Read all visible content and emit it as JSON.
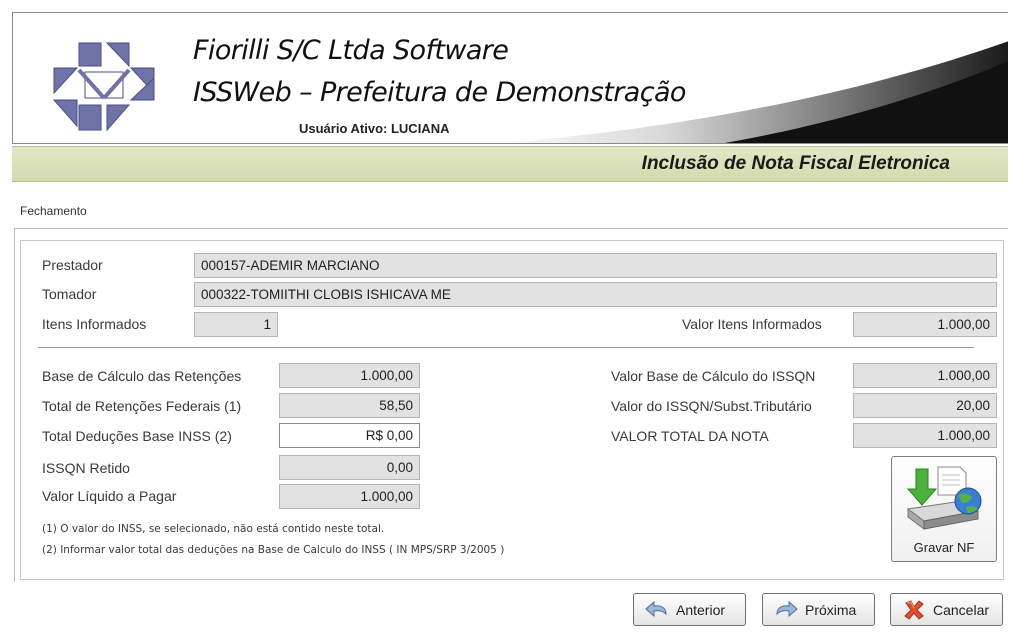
{
  "header": {
    "company": "Fiorilli S/C Ltda Software",
    "system": "ISSWeb – Prefeitura de Demonstração",
    "user_active": "Usuário Ativo: LUCIANA"
  },
  "page_title": "Inclusão de Nota Fiscal Eletronica",
  "tab": "Fechamento",
  "form": {
    "prestador_label": "Prestador",
    "prestador_value": "000157-ADEMIR MARCIANO",
    "tomador_label": "Tomador",
    "tomador_value": "000322-TOMIITHI CLOBIS ISHICAVA ME",
    "itens_label": "Itens Informados",
    "itens_value": "1",
    "valor_itens_label": "Valor Itens Informados",
    "valor_itens_value": "1.000,00",
    "base_retencoes_label": "Base de Cálculo das Retenções",
    "base_retencoes_value": "1.000,00",
    "total_retencoes_label": "Total de Retenções Federais (1)",
    "total_retencoes_value": "58,50",
    "total_deducoes_label": "Total Deduções Base INSS (2)",
    "total_deducoes_value": "R$ 0,00",
    "issqn_retido_label": "ISSQN Retido",
    "issqn_retido_value": "0,00",
    "valor_liquido_label": "Valor Líquido a Pagar",
    "valor_liquido_value": "1.000,00",
    "valor_base_issqn_label": "Valor Base de Cálculo do ISSQN",
    "valor_base_issqn_value": "1.000,00",
    "valor_issqn_label": "Valor do ISSQN/Subst.Tributário",
    "valor_issqn_value": "20,00",
    "valor_total_label": "VALOR TOTAL DA NOTA",
    "valor_total_value": "1.000,00"
  },
  "notes": {
    "note1": "(1) O valor do INSS, se selecionado, não está contido neste total.",
    "note2": "(2) Informar valor total das deduções na Base de Calculo do INSS ( IN MPS/SRP 3/2005 )"
  },
  "buttons": {
    "gravar": "Gravar NF",
    "anterior": "Anterior",
    "proxima": "Próxima",
    "cancelar": "Cancelar"
  },
  "icons": {
    "gravar": "save-disk-globe-icon",
    "anterior": "back-arrow-icon",
    "proxima": "forward-arrow-icon",
    "cancelar": "cancel-x-icon"
  },
  "colors": {
    "title_band": "#d8e0b6",
    "logo": "#6f73a8"
  }
}
